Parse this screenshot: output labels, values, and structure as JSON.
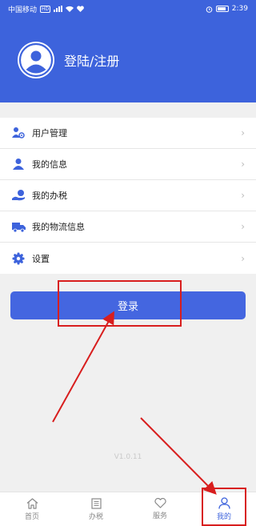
{
  "status_bar": {
    "carrier": "中国移动",
    "hd": "HD",
    "time": "2:39"
  },
  "header": {
    "title": "登陆/注册"
  },
  "menu": {
    "items": [
      {
        "label": "用户管理",
        "icon": "user-manage-icon"
      },
      {
        "label": "我的信息",
        "icon": "person-icon"
      },
      {
        "label": "我的办税",
        "icon": "tax-hand-icon"
      },
      {
        "label": "我的物流信息",
        "icon": "truck-icon"
      },
      {
        "label": "设置",
        "icon": "gear-icon"
      }
    ]
  },
  "login_button": {
    "label": "登录"
  },
  "version": "V1.0.11",
  "tabbar": {
    "tabs": [
      {
        "label": "首页",
        "icon": "home-icon"
      },
      {
        "label": "办税",
        "icon": "document-icon"
      },
      {
        "label": "服务",
        "icon": "heart-icon"
      },
      {
        "label": "我的",
        "icon": "profile-icon",
        "active": true
      }
    ]
  },
  "colors": {
    "brand": "#3d63dc",
    "button": "#4466e0",
    "annotation": "#d81e1e"
  }
}
